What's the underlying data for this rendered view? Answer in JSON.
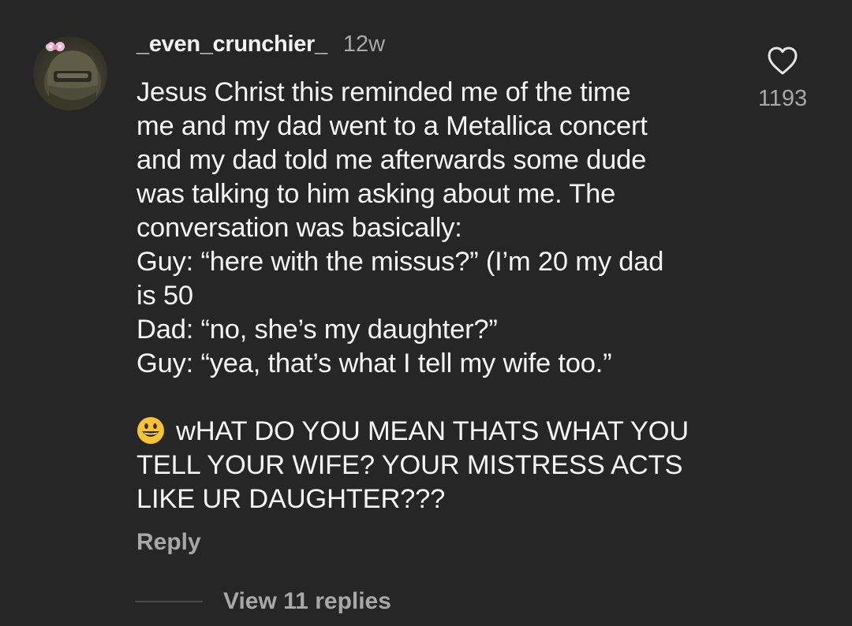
{
  "comment": {
    "username": "_even_crunchier_",
    "time_ago": "12w",
    "lines": [
      "Jesus Christ this reminded me of the time",
      "me and my dad went to a Metallica concert",
      "and my dad told me afterwards some dude",
      "was talking to him asking about me. The",
      "conversation was basically:",
      "Guy: “here with the missus?” (I’m 20 my dad",
      "is 50",
      "Dad: “no, she’s my daughter?”",
      "Guy: “yea, that’s what I tell my wife too.”"
    ],
    "emoji_icon": "grinning-face-emoji",
    "shout_lines": [
      "wHAT DO YOU MEAN THATS WHAT YOU",
      "TELL YOUR WIFE? YOUR MISTRESS ACTS",
      "LIKE UR DAUGHTER???"
    ],
    "reply_label": "Reply",
    "like_icon": "heart-outline-icon",
    "like_count": "1193",
    "view_replies_label": "View 11 replies"
  },
  "colors": {
    "background": "#262626",
    "primary_text": "#f5f5f5",
    "secondary_text": "#a8a8a8",
    "emoji_yellow": "#f7c32e"
  }
}
